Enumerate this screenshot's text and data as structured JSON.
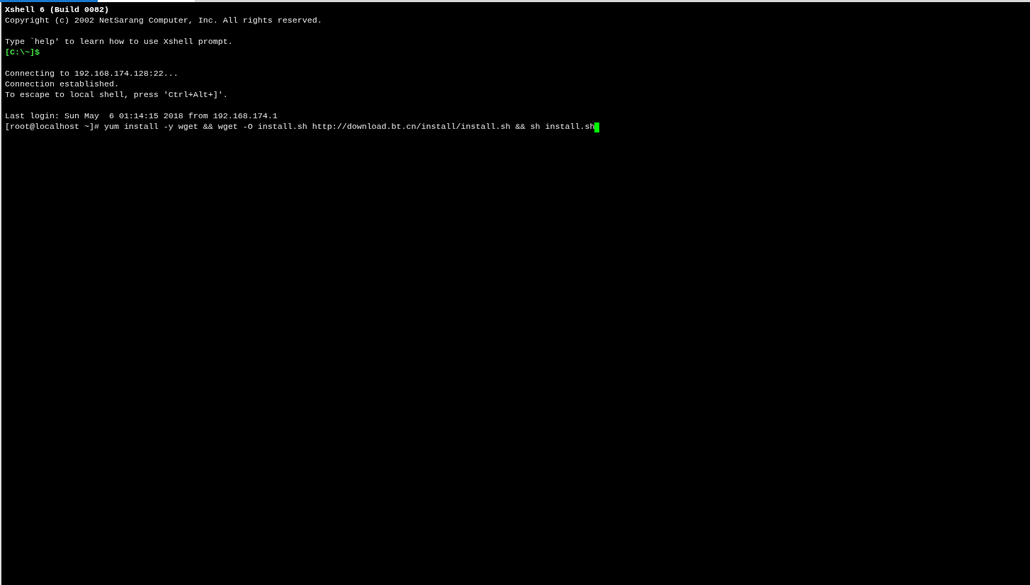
{
  "terminal": {
    "lines": [
      {
        "kind": "bold",
        "text": "Xshell 6 (Build 0082)"
      },
      {
        "kind": "normal",
        "text": "Copyright (c) 2002 NetSarang Computer, Inc. All rights reserved."
      },
      {
        "kind": "blank"
      },
      {
        "kind": "normal",
        "text": "Type `help' to learn how to use Xshell prompt."
      },
      {
        "kind": "prompt",
        "text": "[C:\\~]$"
      },
      {
        "kind": "blank"
      },
      {
        "kind": "normal",
        "text": "Connecting to 192.168.174.128:22..."
      },
      {
        "kind": "normal",
        "text": "Connection established."
      },
      {
        "kind": "normal",
        "text": "To escape to local shell, press 'Ctrl+Alt+]'."
      },
      {
        "kind": "blank"
      },
      {
        "kind": "normal",
        "text": "Last login: Sun May  6 01:14:15 2018 from 192.168.174.1"
      },
      {
        "kind": "normal",
        "text": "[root@localhost ~]# yum install -y wget && wget -O install.sh http://download.bt.cn/install/install.sh && sh install.sh",
        "cursor": true
      }
    ]
  }
}
